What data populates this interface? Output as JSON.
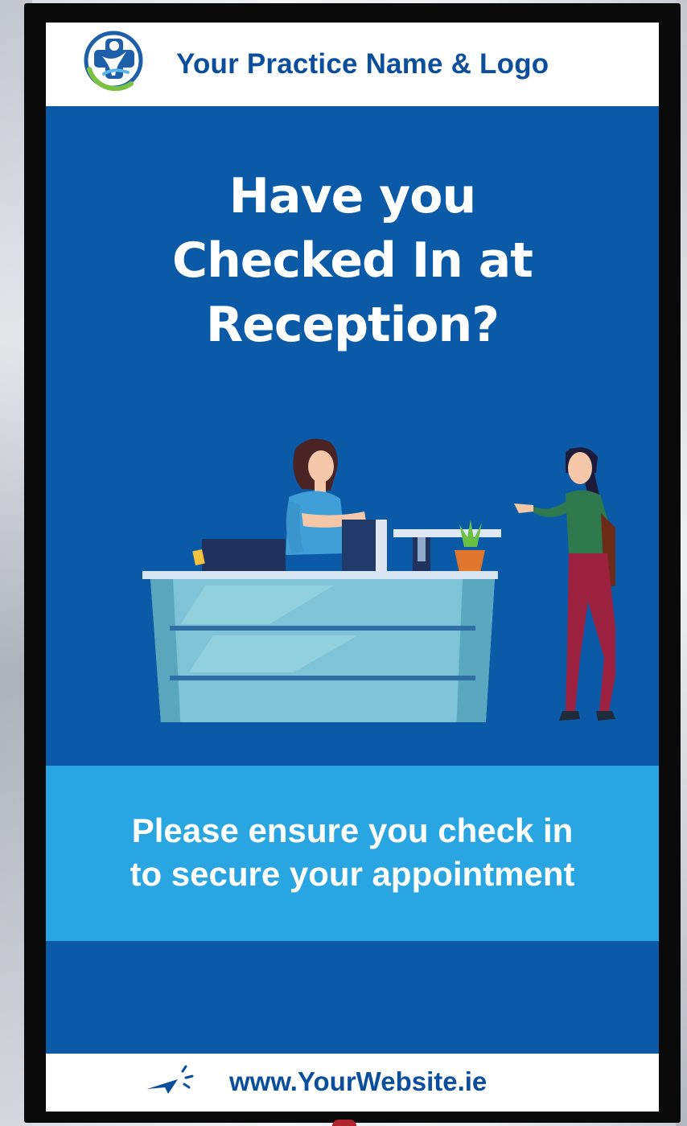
{
  "header": {
    "practice_name": "Your Practice Name & Logo",
    "logo_icon": "medical-cross-person-logo-icon"
  },
  "headline": {
    "line1": "Have you",
    "line2": "Checked In at",
    "line3": "Reception?"
  },
  "illustration": {
    "icon": "reception-desk-scene-illustration"
  },
  "message": {
    "line1": "Please ensure you check in",
    "line2": "to secure your appointment"
  },
  "footer": {
    "website": "www.YourWebsite.ie",
    "icon": "cursor-click-arrow-icon"
  },
  "colors": {
    "primary_blue": "#0a5aa8",
    "light_blue": "#29a6e1",
    "text_blue": "#0b4f9c",
    "white": "#ffffff"
  }
}
